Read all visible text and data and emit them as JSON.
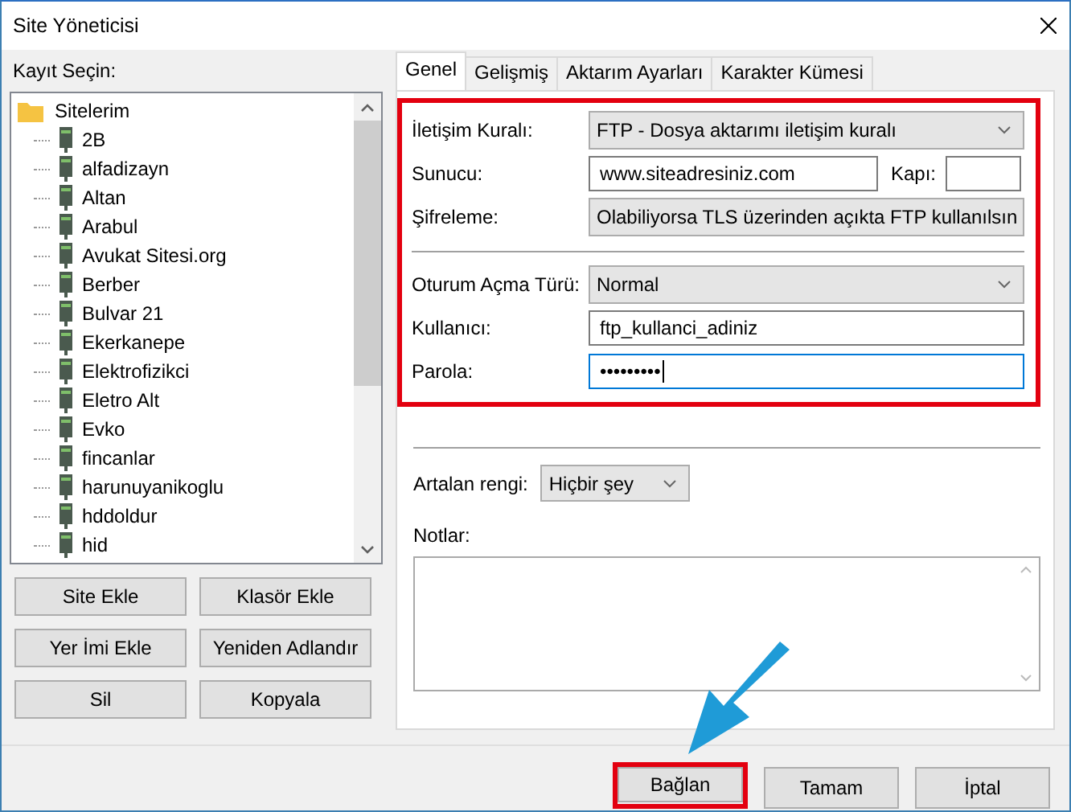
{
  "window": {
    "title": "Site Yöneticisi"
  },
  "tree": {
    "label": "Kayıt Seçin:",
    "root": {
      "name": "Sitelerim",
      "expanded": true,
      "children": [
        {
          "name": "2B"
        },
        {
          "name": "alfadizayn"
        },
        {
          "name": "Altan"
        },
        {
          "name": "Arabul"
        },
        {
          "name": "Avukat Sitesi.org"
        },
        {
          "name": "Berber"
        },
        {
          "name": "Bulvar 21"
        },
        {
          "name": "Ekerkanepe"
        },
        {
          "name": "Elektrofizikci"
        },
        {
          "name": "Eletro Alt"
        },
        {
          "name": "Evko"
        },
        {
          "name": "fincanlar"
        },
        {
          "name": "harunuyanikoglu"
        },
        {
          "name": "hddoldur"
        },
        {
          "name": "hid"
        }
      ]
    }
  },
  "left_buttons": [
    "Site Ekle",
    "Klasör Ekle",
    "Yer İmi Ekle",
    "Yeniden Adlandır",
    "Sil",
    "Kopyala"
  ],
  "tabs": [
    {
      "label": "Genel",
      "selected": true
    },
    {
      "label": "Gelişmiş",
      "selected": false
    },
    {
      "label": "Aktarım Ayarları",
      "selected": false
    },
    {
      "label": "Karakter Kümesi",
      "selected": false
    }
  ],
  "general": {
    "highlighted": true,
    "groups": [
      [
        {
          "kind": "select",
          "label": "İletişim Kuralı:",
          "value": "FTP - Dosya aktarımı iletişim kuralı"
        },
        {
          "kind": "host",
          "label": "Sunucu:",
          "value": "www.siteadresiniz.com",
          "port_label": "Kapı:"
        },
        {
          "kind": "select",
          "label": "Şifreleme:",
          "value": "Olabiliyorsa TLS üzerinden açıkta FTP kullanılsın"
        }
      ],
      [
        {
          "kind": "select",
          "label": "Oturum Açma Türü:",
          "value": "Normal"
        },
        {
          "kind": "text",
          "label": "Kullanıcı:",
          "value": "ftp_kullanci_adiniz",
          "focused": false
        },
        {
          "kind": "text",
          "label": "Parola:",
          "value": "•••••••••",
          "focused": true
        }
      ]
    ]
  },
  "background_color": {
    "label": "Artalan rengi:",
    "value": "Hiçbir şey"
  },
  "notes": {
    "label": "Notlar:"
  },
  "dialog_buttons": [
    {
      "label": "Bağlan",
      "highlighted": true
    },
    {
      "label": "Tamam",
      "highlighted": false
    },
    {
      "label": "İptal",
      "highlighted": false
    }
  ]
}
